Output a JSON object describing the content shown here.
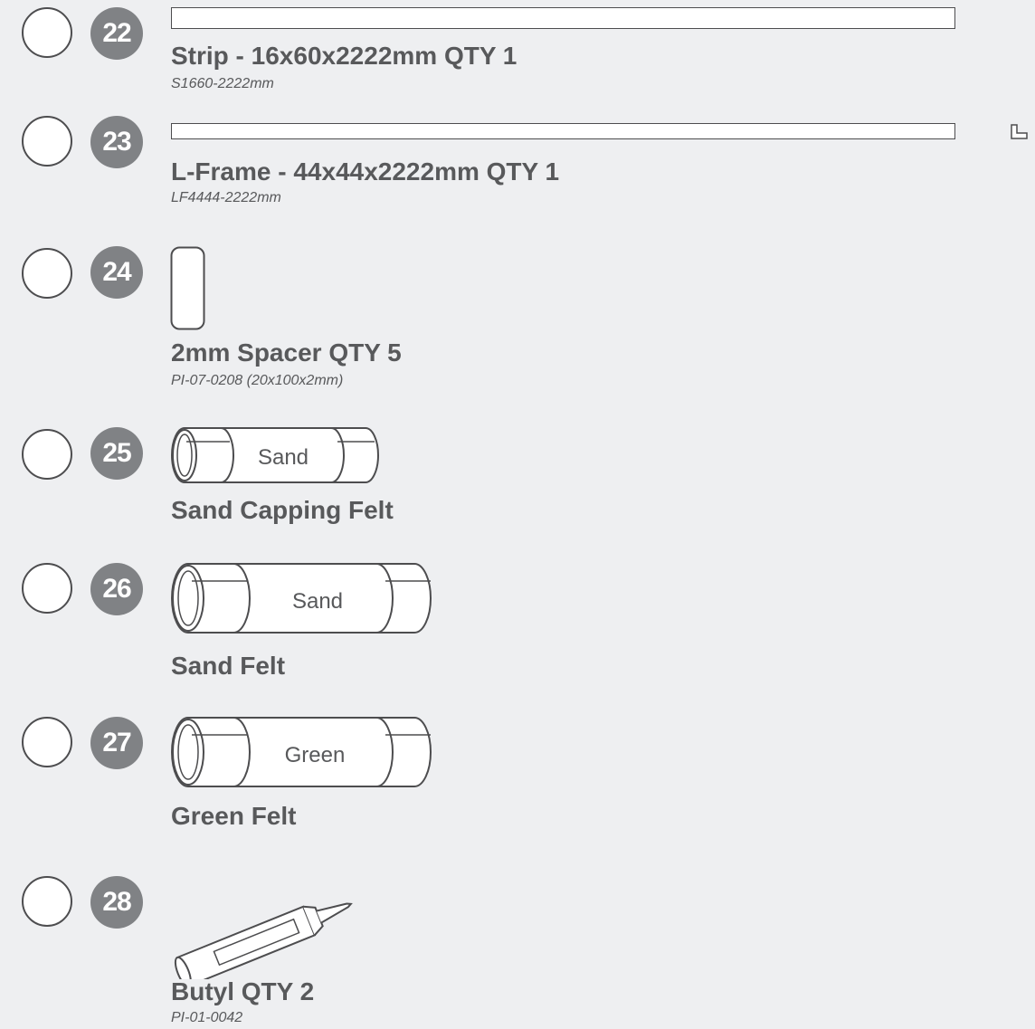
{
  "items": [
    {
      "number": "22",
      "title": "Strip - 16x60x2222mm QTY 1",
      "code": "S1660-2222mm",
      "icon": "strip-bar"
    },
    {
      "number": "23",
      "title": "L-Frame - 44x44x2222mm QTY 1",
      "code": "LF4444-2222mm",
      "icon": "l-frame-bar"
    },
    {
      "number": "24",
      "title": "2mm Spacer QTY 5",
      "code": "PI-07-0208 (20x100x2mm)",
      "icon": "spacer-icon"
    },
    {
      "number": "25",
      "title": "Sand Capping Felt",
      "roll_label": "Sand",
      "icon": "felt-roll-icon"
    },
    {
      "number": "26",
      "title": "Sand Felt",
      "roll_label": "Sand",
      "icon": "felt-roll-icon"
    },
    {
      "number": "27",
      "title": "Green Felt",
      "roll_label": "Green",
      "icon": "felt-roll-icon"
    },
    {
      "number": "28",
      "title": "Butyl QTY 2",
      "code": "PI-01-0042",
      "icon": "sealant-tube-icon"
    }
  ],
  "colors": {
    "background": "#eeeff1",
    "badge": "#808285",
    "text": "#58595b",
    "outline": "#4d4d4f"
  }
}
